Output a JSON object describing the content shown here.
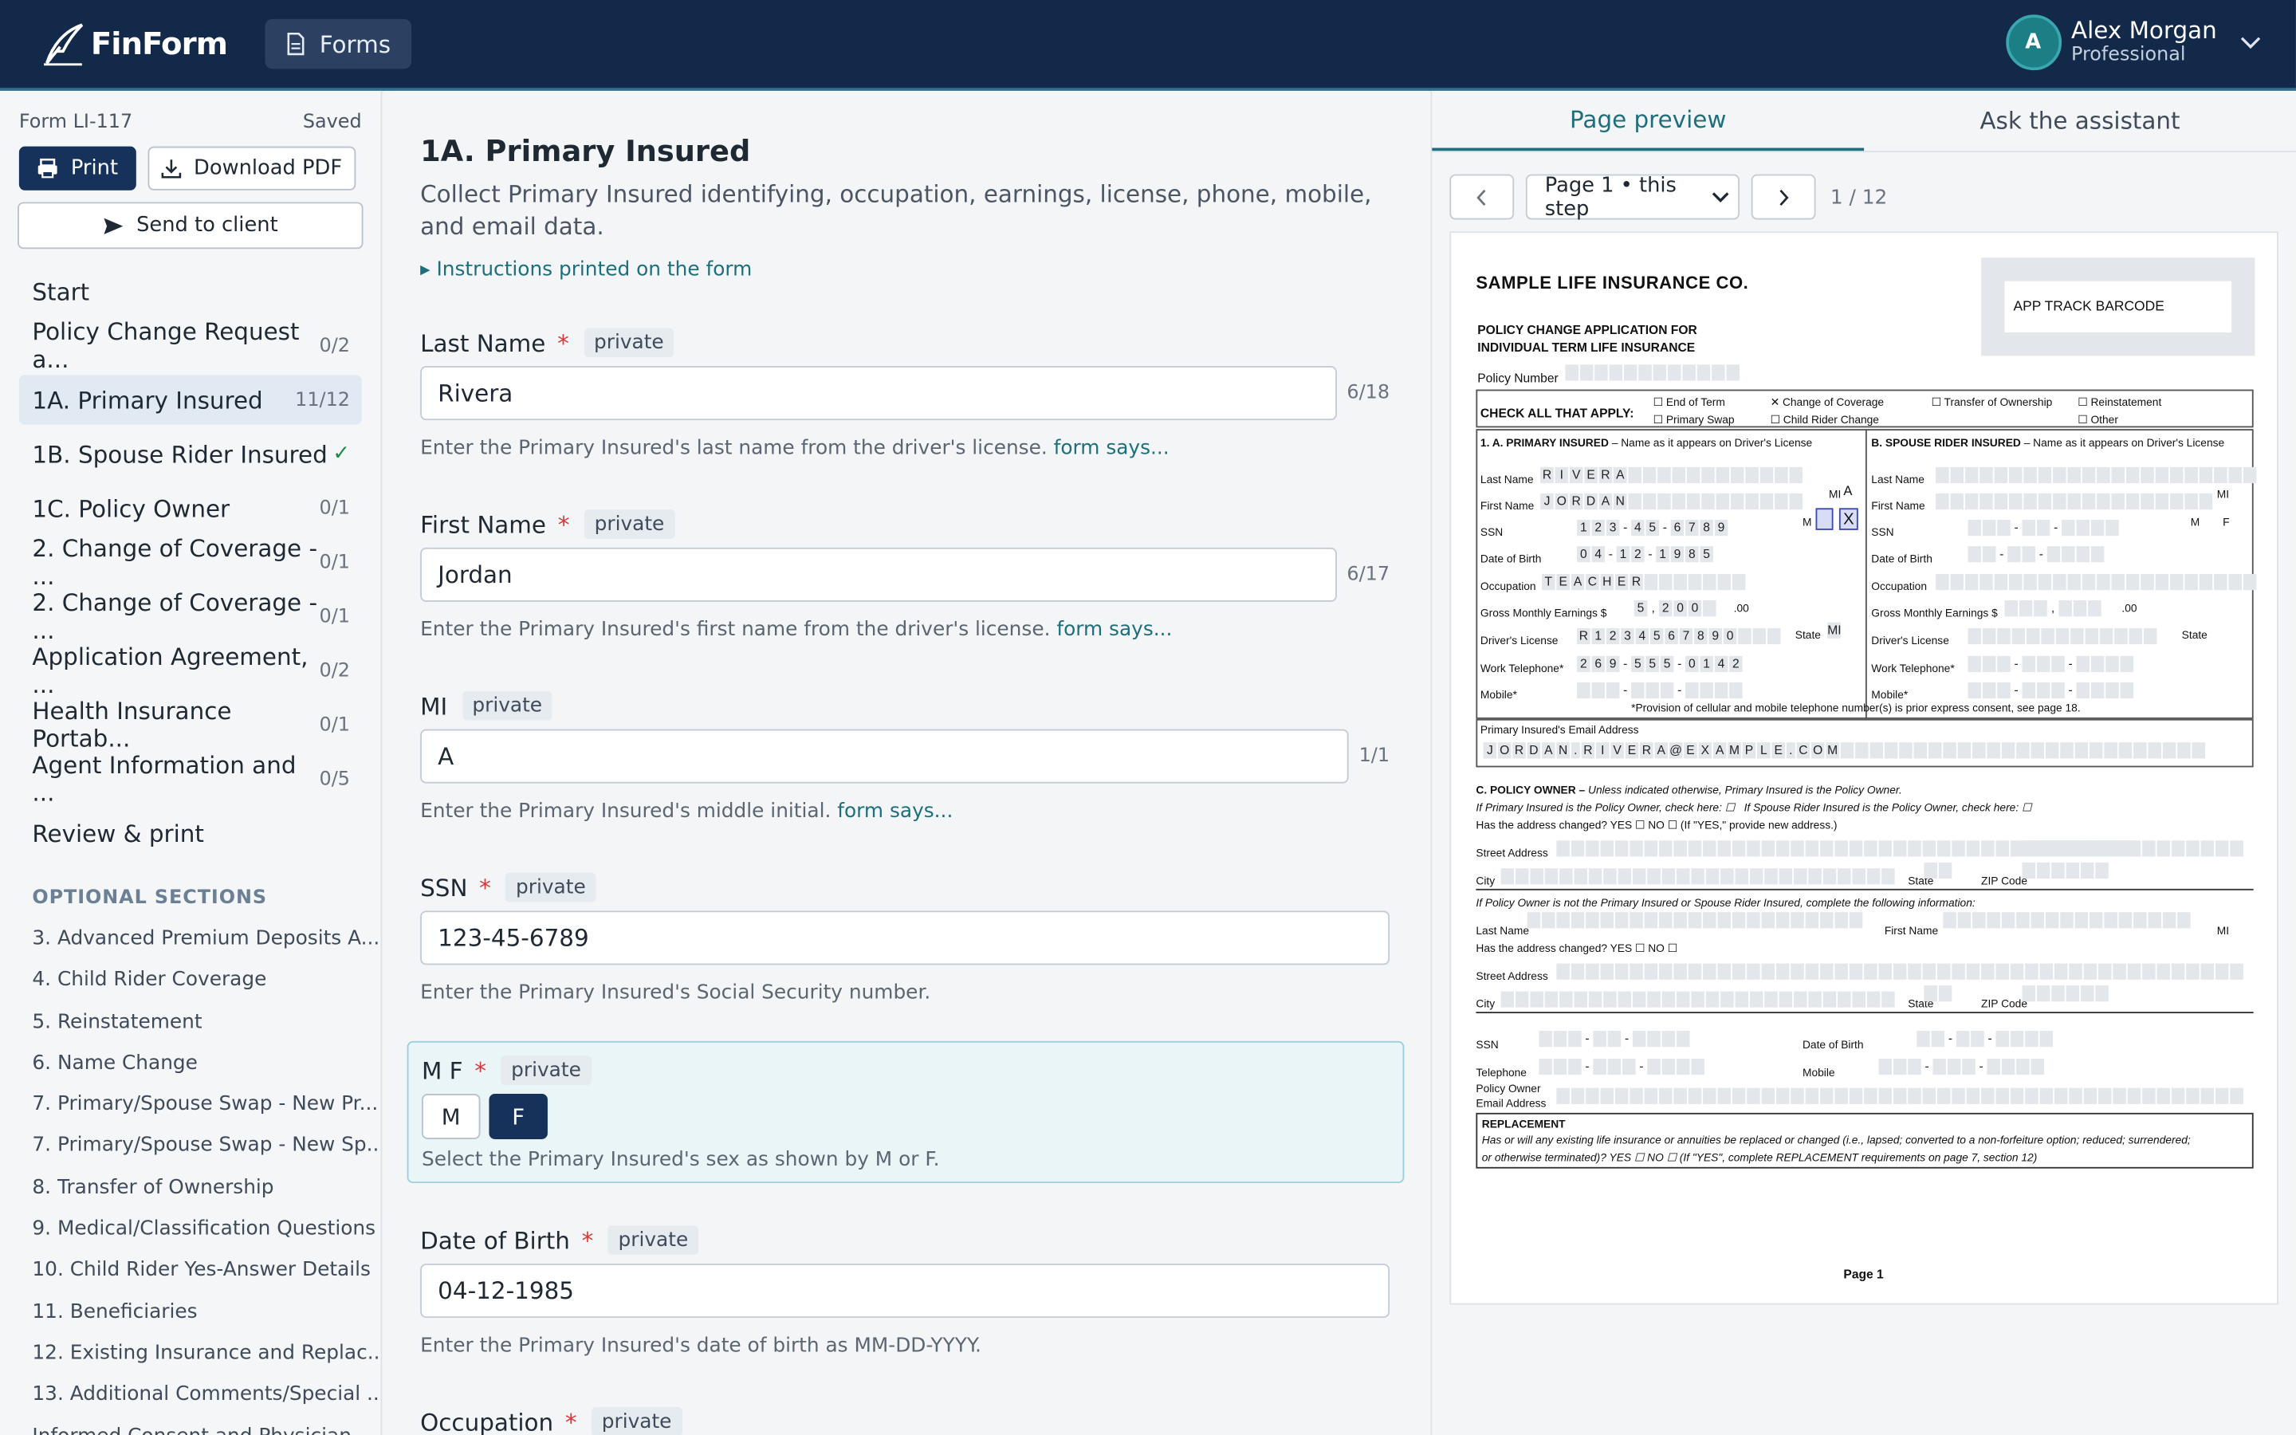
{
  "app": {
    "name": "FinForm",
    "forms_label": "Forms"
  },
  "user": {
    "initial": "A",
    "name": "Alex Morgan",
    "role": "Professional"
  },
  "form": {
    "id": "Form LI-117",
    "status": "Saved"
  },
  "actions": {
    "print": "Print",
    "download": "Download PDF",
    "send": "Send to client"
  },
  "nav": [
    {
      "label": "Start",
      "count": ""
    },
    {
      "label": "Policy Change Request a...",
      "count": "0/2"
    },
    {
      "label": "1A. Primary Insured",
      "count": "11/12"
    },
    {
      "label": "1B. Spouse Rider Insured",
      "count": "✓"
    },
    {
      "label": "1C. Policy Owner",
      "count": "0/1"
    },
    {
      "label": "2. Change of Coverage - ...",
      "count": "0/1"
    },
    {
      "label": "2. Change of Coverage - ...",
      "count": "0/1"
    },
    {
      "label": "Application Agreement, ...",
      "count": "0/2"
    },
    {
      "label": "Health Insurance Portab...",
      "count": "0/1"
    },
    {
      "label": "Agent Information and ...",
      "count": "0/5"
    },
    {
      "label": "Review & print",
      "count": ""
    }
  ],
  "optional": {
    "title": "OPTIONAL SECTIONS",
    "items": [
      "3. Advanced Premium Deposits A...",
      "4. Child Rider Coverage",
      "5. Reinstatement",
      "6. Name Change",
      "7. Primary/Spouse Swap - New Pr...",
      "7. Primary/Spouse Swap - New Sp...",
      "8. Transfer of Ownership",
      "9. Medical/Classification Questions",
      "10. Child Rider Yes-Answer Details",
      "11. Beneficiaries",
      "12. Existing Insurance and Replac...",
      "13. Additional Comments/Special ...",
      "Informed Consent and Physician..."
    ]
  },
  "section": {
    "title": "1A. Primary Insured",
    "description": "Collect Primary Insured identifying, occupation, earnings, license, phone, mobile, and email data.",
    "instructions": "Instructions printed on the form"
  },
  "fields": {
    "private_tag": "private",
    "required": "*",
    "form_says": "form says...",
    "last": {
      "label": "Last Name",
      "value": "Rivera",
      "count": "6/18",
      "help": "Enter the Primary Insured's last name from the driver's license."
    },
    "first": {
      "label": "First Name",
      "value": "Jordan",
      "count": "6/17",
      "help": "Enter the Primary Insured's first name from the driver's license."
    },
    "mi": {
      "label": "MI",
      "value": "A",
      "count": "1/1",
      "help": "Enter the Primary Insured's middle initial."
    },
    "ssn": {
      "label": "SSN",
      "value": "123-45-6789",
      "help": "Enter the Primary Insured's Social Security number."
    },
    "sex": {
      "label": "M F",
      "options": [
        "M",
        "F"
      ],
      "selected": "F",
      "help": "Select the Primary Insured's sex as shown by M or F."
    },
    "dob": {
      "label": "Date of Birth",
      "value": "04-12-1985",
      "help": "Enter the Primary Insured's date of birth as MM-DD-YYYY."
    },
    "occ": {
      "label": "Occupation"
    }
  },
  "preview": {
    "tab_preview": "Page preview",
    "tab_assistant": "Ask the assistant",
    "page_select": "Page 1 • this step",
    "page_num": "1 / 12"
  },
  "doc": {
    "company": "SAMPLE LIFE INSURANCE CO.",
    "barcode": "APP TRACK BARCODE",
    "title1": "POLICY CHANGE APPLICATION FOR",
    "title2": "INDIVIDUAL TERM LIFE INSURANCE",
    "policy_number": "Policy Number",
    "check_all": "CHECK ALL THAT APPLY:",
    "opts": [
      "End of Term",
      "Change of Coverage",
      "Transfer of Ownership",
      "Reinstatement",
      "Primary Swap",
      "Child Rider Change",
      "Other"
    ],
    "sec_a": "1. A. PRIMARY INSURED",
    "sec_a_sub": "– Name as it appears on Driver's License",
    "sec_b": "B. SPOUSE RIDER INSURED",
    "sec_b_sub": "– Name as it appears on Driver's License",
    "rows": [
      "Last Name",
      "First Name",
      "SSN",
      "Date of Birth",
      "Occupation",
      "Gross Monthly Earnings $",
      "Driver's License",
      "Work Telephone*",
      "Mobile*"
    ],
    "vals": {
      "last": "RIVERA",
      "first": "JORDAN",
      "mi": "A",
      "ssn": "123-45-6789",
      "dob": "04-12-1985",
      "occ": "TEACHER",
      "earn": "5,200",
      "dl": "R1234567890",
      "state": "MI",
      "tel": "269-555-0142",
      "email": "JORDAN.RIVERA@EXAMPLE.COM"
    },
    "mi_label": "MI",
    "m_label": "M",
    "f_label": "F",
    "x_mark": "X",
    "state_label": "State",
    "cents": ".00",
    "provision": "*Provision of cellular and mobile telephone number(s) is prior express consent, see page 18.",
    "email_label": "Primary Insured's Email Address",
    "owner_title": "C. POLICY OWNER –",
    "owner_sub": "Unless indicated otherwise, Primary Insured is the Policy Owner.",
    "owner_l1": "If Primary Insured is the Policy Owner, check here:",
    "owner_l1b": "If Spouse Rider Insured is the Policy Owner, check here:",
    "addr_changed": "Has the address changed? YES",
    "no": "NO",
    "if_yes": "(If \"YES,\" provide new address.)",
    "street": "Street Address",
    "city": "City",
    "state": "State",
    "zip": "ZIP Code",
    "not_owner": "If Policy Owner is not the Primary Insured or Spouse Rider Insured, complete the following information:",
    "first_name": "First Name",
    "telephone": "Telephone",
    "mobile": "Mobile",
    "po_email1": "Policy Owner",
    "po_email2": "Email Address",
    "repl_title": "REPLACEMENT",
    "repl_text1": "Has or will any existing life insurance or annuities be replaced or changed (i.e., lapsed; converted to a non-forfeiture option; reduced; surrendered;",
    "repl_text2": "or otherwise terminated)? YES",
    "repl_text3": "(If \"YES\", complete REPLACEMENT requirements on page 7, section 12)",
    "page_label": "Page 1"
  }
}
